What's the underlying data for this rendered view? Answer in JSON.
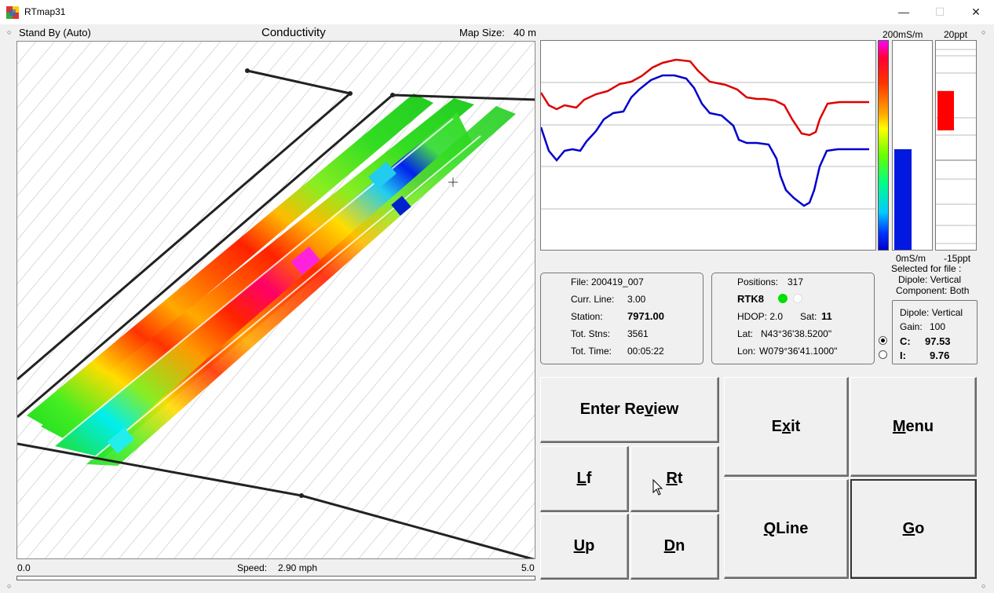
{
  "window": {
    "title": "RTmap31"
  },
  "header": {
    "status": "Stand By (Auto)",
    "map_title": "Conductivity",
    "map_size_label": "Map Size:",
    "map_size_value": "40 m"
  },
  "footer": {
    "scale_min": "0.0",
    "speed_label": "Speed:",
    "speed_value": "2.90 mph",
    "scale_max": "5.0"
  },
  "scales": {
    "cond_top": "200mS/m",
    "ip_top": "20ppt",
    "cond_bottom": "0mS/m",
    "ip_bottom": "-15ppt",
    "cond_level_fraction": 0.48,
    "ip_bar_range_ppt": [
      5.0,
      11.6
    ]
  },
  "selected": {
    "title": "Selected for file :",
    "dipole": "Dipole: Vertical",
    "component": "Component: Both"
  },
  "file_panel": {
    "file": "File: 200419_007",
    "curr_line_label": "Curr. Line:",
    "curr_line_value": "3.00",
    "station_label": "Station:",
    "station_value": "7971.00",
    "tot_stns_label": "Tot. Stns:",
    "tot_stns_value": "3561",
    "tot_time_label": "Tot. Time:",
    "tot_time_value": "00:05:22"
  },
  "gps_panel": {
    "positions_label": "Positions:",
    "positions_value": "317",
    "fix": "RTK8",
    "hdop": "HDOP: 2.0",
    "sat_label": "Sat:",
    "sat_value": "11",
    "lat_label": "Lat:",
    "lat_value": "N43°36'38.5200\"",
    "lon_label": "Lon:",
    "lon_value": "W079°36'41.1000\"",
    "status_colors": [
      "#00e000",
      "#ffffff"
    ]
  },
  "dipole_panel": {
    "dipole": "Dipole: Vertical",
    "gain_label": "Gain:",
    "gain_value": "100",
    "c_label": "C:",
    "c_value": "97.53",
    "i_label": "I:",
    "i_value": "9.76",
    "selected_radio": "C"
  },
  "buttons": {
    "enter_review": [
      "Enter Re",
      "v",
      "iew"
    ],
    "exit": [
      "E",
      "x",
      "it"
    ],
    "menu": [
      "",
      "M",
      "enu"
    ],
    "lf": [
      "",
      "L",
      "f"
    ],
    "rt": [
      "",
      "R",
      "t"
    ],
    "qline": [
      "",
      "Q",
      "Line"
    ],
    "go": [
      "",
      "G",
      "o"
    ],
    "up": [
      "",
      "U",
      "p"
    ],
    "dn": [
      "",
      "D",
      "n"
    ]
  },
  "colors": {
    "inphase_line": "#dd0000",
    "quad_line": "#0000cc",
    "bar_fill": "#0018e0",
    "ip_fill": "#ff0000"
  }
}
